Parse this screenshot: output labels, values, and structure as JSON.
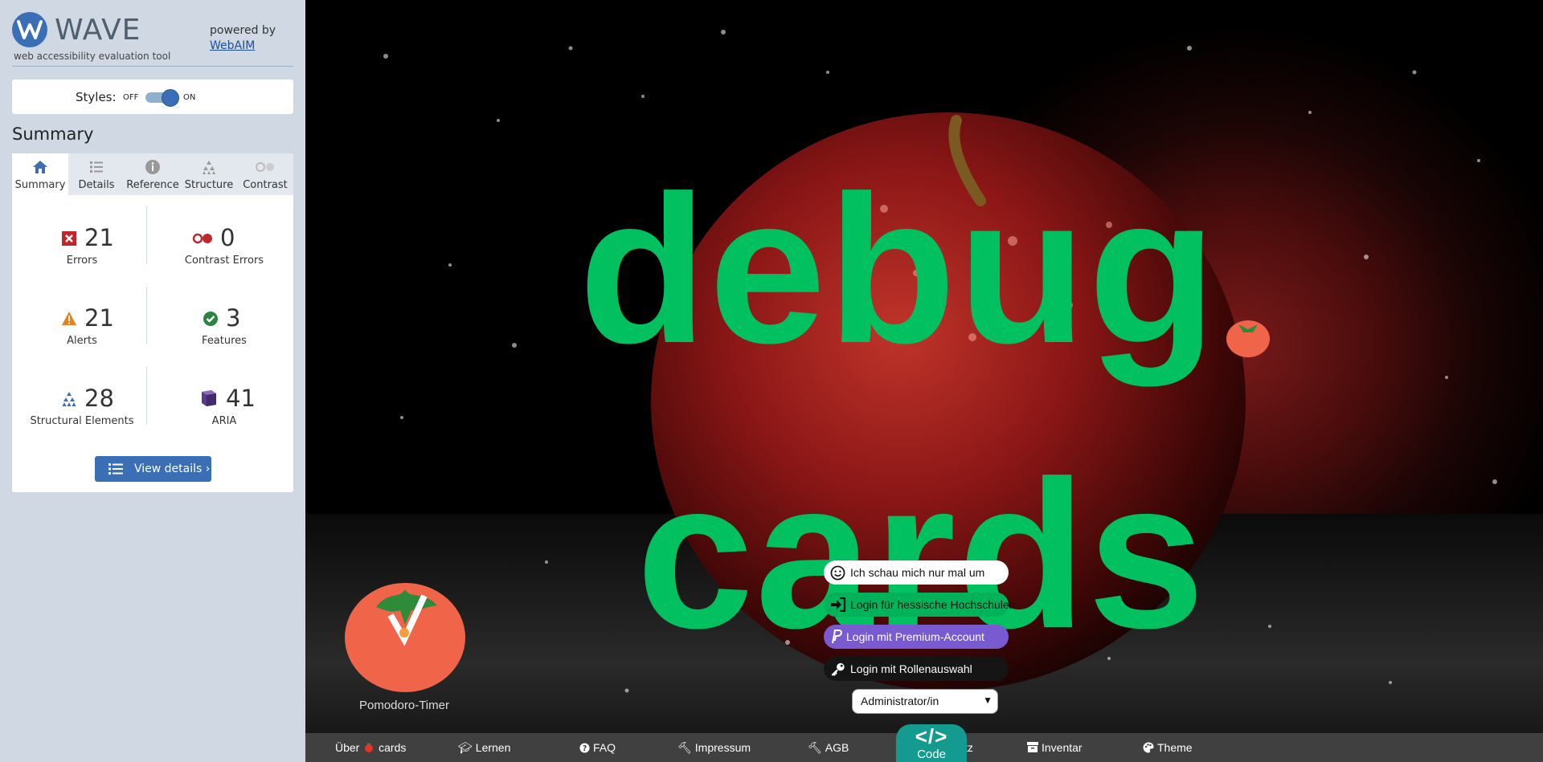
{
  "wave": {
    "logo_text": "WAVE",
    "tagline": "web accessibility evaluation tool",
    "powered_by": "powered by",
    "webaim_link": "WebAIM",
    "styles_label": "Styles:",
    "styles_off": "OFF",
    "styles_on": "ON",
    "styles_enabled": true,
    "summary_title": "Summary",
    "tabs": [
      {
        "label": "Summary",
        "icon": "home-icon",
        "active": true
      },
      {
        "label": "Details",
        "icon": "list-icon",
        "active": false
      },
      {
        "label": "Reference",
        "icon": "info-icon",
        "active": false
      },
      {
        "label": "Structure",
        "icon": "structure-icon",
        "active": false
      },
      {
        "label": "Contrast",
        "icon": "contrast-icon",
        "active": false
      }
    ],
    "stats": [
      {
        "count": "21",
        "label": "Errors",
        "icon": "error-icon",
        "color": "#c0272d"
      },
      {
        "count": "0",
        "label": "Contrast Errors",
        "icon": "contrast-error-icon",
        "color": "#c0272d"
      },
      {
        "count": "21",
        "label": "Alerts",
        "icon": "alert-icon",
        "color": "#e8821e"
      },
      {
        "count": "3",
        "label": "Features",
        "icon": "feature-icon",
        "color": "#2e8540"
      },
      {
        "count": "28",
        "label": "Structural Elements",
        "icon": "structure-icon",
        "color": "#3a6fb5"
      },
      {
        "count": "41",
        "label": "ARIA",
        "icon": "aria-icon",
        "color": "#5b3a8c"
      }
    ],
    "view_details": "View details ›"
  },
  "page": {
    "hero_line1": "debug",
    "hero_line2": "cards",
    "pomodoro_label": "Pomodoro-Timer",
    "login_buttons": [
      {
        "label": "Ich schau mich nur mal um",
        "icon": "smile-icon"
      },
      {
        "label": "Login für hessische Hochschulen",
        "icon": "sign-in-icon"
      },
      {
        "label": "Login mit Premium-Account",
        "icon": "paypal-icon"
      },
      {
        "label": "Login mit Rollenauswahl",
        "icon": "key-icon"
      }
    ],
    "role_select_value": "Administrator/in",
    "code_tab": {
      "icon": "</>",
      "label": "Code"
    },
    "footer": [
      {
        "pre": "Über",
        "post": "cards",
        "icon": "tomato-icon"
      },
      {
        "label": "Lernen",
        "icon": "graduation-cap-icon"
      },
      {
        "label": "FAQ",
        "icon": "question-circle-icon"
      },
      {
        "label": "Impressum",
        "icon": "gavel-icon"
      },
      {
        "label": "AGB",
        "icon": "gavel-icon"
      },
      {
        "label": "tz",
        "icon": ""
      },
      {
        "label": "Inventar",
        "icon": "archive-icon"
      },
      {
        "label": "Theme",
        "icon": "palette-icon"
      }
    ]
  },
  "colors": {
    "wave_blue": "#3a6fb5",
    "brand_green": "#00c060",
    "premium_purple": "#7a5ad1",
    "code_teal": "#139b8f",
    "footer_bg": "#404040"
  }
}
